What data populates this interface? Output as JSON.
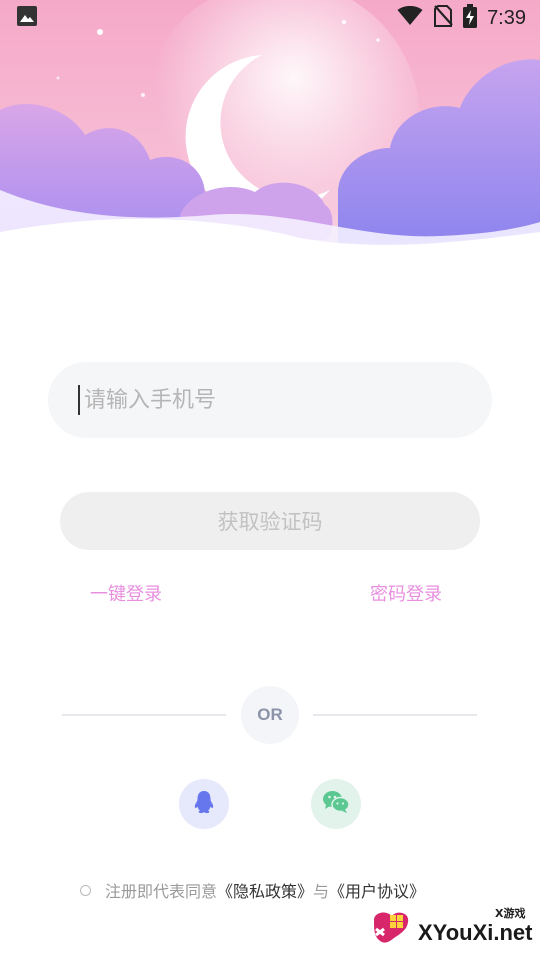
{
  "status_bar": {
    "time": "7:39",
    "icons": [
      "gallery-icon",
      "wifi-icon",
      "no-sim-icon",
      "battery-charging-icon"
    ]
  },
  "login": {
    "phone_placeholder": "请输入手机号",
    "phone_value": "",
    "get_code_label": "获取验证码",
    "one_click_login": "一键登录",
    "password_login": "密码登录"
  },
  "divider": {
    "label": "OR"
  },
  "social": [
    {
      "name": "qq",
      "icon": "qq-penguin-icon",
      "color": "#6677ee"
    },
    {
      "name": "wechat",
      "icon": "wechat-icon",
      "color": "#5bc891"
    }
  ],
  "agreement": {
    "prefix": "注册即代表同意",
    "privacy": "《隐私政策》",
    "conjunction": "与",
    "terms": "《用户协议》"
  },
  "watermark": {
    "top": "X游戏",
    "main": "XYouXi.net"
  },
  "colors": {
    "accent_pink": "#e88fe0",
    "input_bg": "#f5f6f8",
    "button_bg": "#efefef"
  }
}
